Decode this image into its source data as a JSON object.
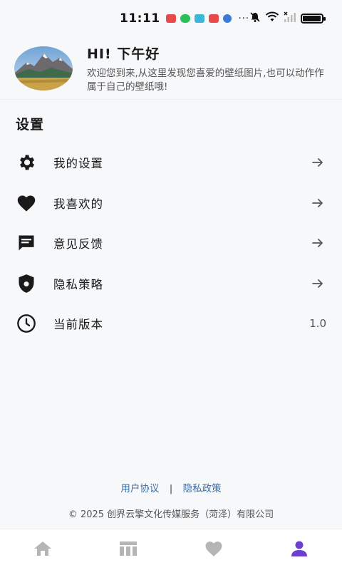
{
  "status_bar": {
    "time": "11:11",
    "dots": "···",
    "battery_level": 0.95
  },
  "profile": {
    "greeting": "HI! 下午好",
    "subtitle": "欢迎您到来,从这里发现您喜爱的壁纸图片,也可以动作作属于自己的壁纸哦!"
  },
  "settings": {
    "title": "设置",
    "items": [
      {
        "label": "我的设置",
        "icon": "gear-icon",
        "trailing": "arrow"
      },
      {
        "label": "我喜欢的",
        "icon": "heart-icon",
        "trailing": "arrow"
      },
      {
        "label": "意见反馈",
        "icon": "feedback-icon",
        "trailing": "arrow"
      },
      {
        "label": "隐私策略",
        "icon": "shield-icon",
        "trailing": "arrow"
      },
      {
        "label": "当前版本",
        "icon": "clock-icon",
        "trailing": "value",
        "value": "1.0"
      }
    ]
  },
  "footer": {
    "user_agreement": "用户协议",
    "separator": "|",
    "privacy_policy": "隐私政策",
    "copyright": "© 2025 创界云擎文化传媒服务（菏泽）有限公司"
  },
  "bottom_nav": {
    "items": [
      {
        "icon": "home-icon",
        "active": false
      },
      {
        "icon": "grid-icon",
        "active": false
      },
      {
        "icon": "heart-icon",
        "active": false
      },
      {
        "icon": "person-icon",
        "active": true
      }
    ],
    "active_color": "#6c3fd1",
    "inactive_color": "#b5b5b5"
  }
}
